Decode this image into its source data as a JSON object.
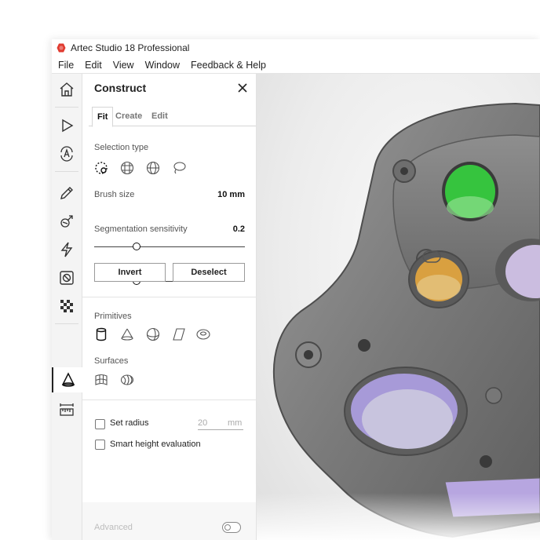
{
  "window": {
    "title": "Artec Studio 18 Professional"
  },
  "menu": [
    "File",
    "Edit",
    "View",
    "Window",
    "Feedback & Help"
  ],
  "toolbar": {
    "icons": [
      "home-icon",
      "play-icon",
      "autopilot-icon",
      "pencil-icon",
      "tools-icon",
      "lightning-icon",
      "mask-icon",
      "texture-icon",
      "construct-icon",
      "measure-icon"
    ],
    "active": "construct-icon"
  },
  "panel": {
    "title": "Construct",
    "tabs": [
      "Fit",
      "Create",
      "Edit"
    ],
    "active_tab": "Fit",
    "selection_type_label": "Selection type",
    "brush_size": {
      "label": "Brush size",
      "value": "10 mm",
      "level": 0.28
    },
    "segmentation": {
      "label": "Segmentation sensitivity",
      "value": "0.2",
      "level": 0.28
    },
    "invert_label": "Invert",
    "deselect_label": "Deselect",
    "primitives_label": "Primitives",
    "surfaces_label": "Surfaces",
    "set_radius": {
      "label": "Set radius",
      "value": "20",
      "unit": "mm",
      "checked": false
    },
    "smart_height": {
      "label": "Smart height evaluation",
      "checked": false
    },
    "advanced_label": "Advanced"
  },
  "colors": {
    "accent_green": "#36c43e",
    "accent_orange": "#d9a040",
    "accent_purple": "#a79ad8",
    "model_gray": "#7d7d7d"
  }
}
